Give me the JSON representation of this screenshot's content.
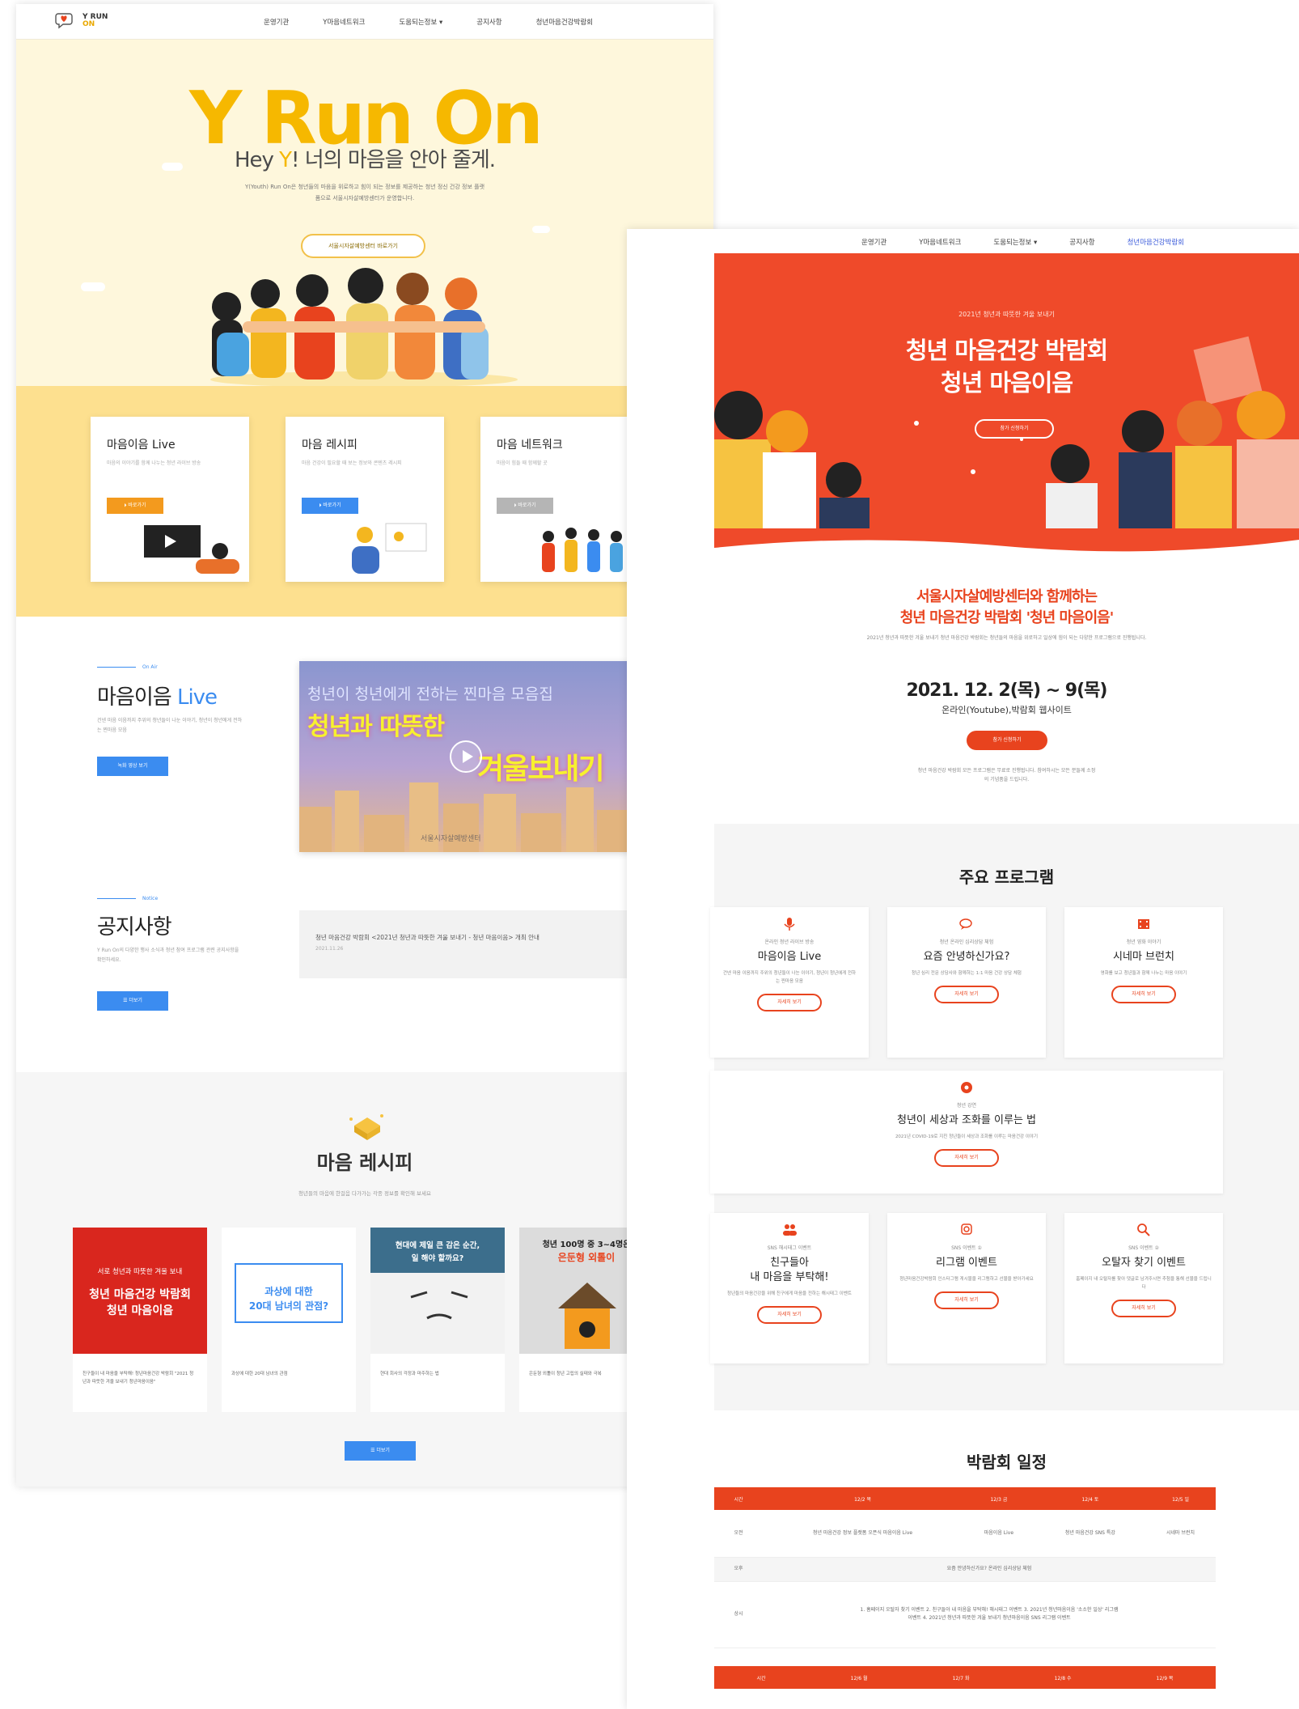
{
  "page1": {
    "logo": {
      "line1": "Y RUN",
      "line2": "ON"
    },
    "nav": [
      "운영기관",
      "Y마음네트워크",
      "도움되는정보 ▾",
      "공지사항",
      "청년마음건강박람회"
    ],
    "hero": {
      "title": "Y Run On",
      "sub_before": "Hey ",
      "sub_y": "Y",
      "sub_after": "! 너의 마음을 안아 줄게.",
      "desc": "Y(Youth) Run On은 청년들의 마음을 위로하고 힘이 되는 정보를 제공하는 청년 정신 건강 정보 플랫폼으로 서울시자살예방센터가 운영합니다.",
      "button": "서울시자살예방센터 바로가기"
    },
    "cards": [
      {
        "title": "마음이음 Live",
        "desc": "마음의 이야기를 함께 나누는 청년 라이브 방송",
        "button": "바로가기",
        "color": "#f39a1e"
      },
      {
        "title": "마음 레시피",
        "desc": "마음 건강이 필요할 때 보는 정보와 콘텐츠 레시피",
        "button": "바로가기",
        "color": "#3b8cf0"
      },
      {
        "title": "마음 네트워크",
        "desc": "마음이 힘들 때 함께할 곳",
        "button": "바로가기",
        "color": "#b5b5b5"
      }
    ],
    "live": {
      "tag": "On Air",
      "title_a": "마음이음",
      "title_b": "Live",
      "desc": "건넨 마음 이음까지 주위의 청년들이 나눈 이야기, 청년이 청년에게 전하는 찐마음 모음",
      "button": "녹화 영상 보기",
      "video_line1": "청년이 청년에게 전하는 찐마음 모음집",
      "video_line2": "청년과 따뜻한",
      "video_line3": "겨울보내기",
      "video_footer": "서울시자살예방센터"
    },
    "notice": {
      "tag": "Notice",
      "title": "공지사항",
      "desc": "Y Run On의 다양한 행사 소식과 청년 참여 프로그램 관련 공지사항을 확인하세요.",
      "button": "더보기",
      "item_title": "청년 마음건강 박람회 <2021년 청년과 따뜻한 겨울 보내기 - 청년 마음이음> 개최 안내",
      "item_date": "2021.11.26"
    },
    "recipe": {
      "title": "마음 레시피",
      "desc": "청년들의 마음에 한걸음 다가가는 각종 정보를 확인해 보세요",
      "cards": [
        {
          "img_line1": "서로 청년과 따뜻한 겨울 보내",
          "img_line2": "청년 마음건강 박람회",
          "img_line3": "청년 마음이음",
          "caption": "친구들이 내 마음을 부탁해! 청년마음건강 박람회 \"2021 청년과 따뜻한 겨울 보내기 청년마음이음\""
        },
        {
          "img_line1": "과상에 대한",
          "img_line2": "20대 남녀의 관점?",
          "caption": "과상에 대한 20대 남녀의 관점"
        },
        {
          "img_line1": "현대에 제일 큰 감은 순간,",
          "img_line2": "일 해야 할까요?",
          "caption": "현대 회사의 걱정과 마주하는 법"
        },
        {
          "img_line1": "청년 100명 중 3~4명은",
          "img_line2": "은둔형 외톨이",
          "caption": "은둔형 외톨이 청년 고립의 실태와 극복"
        }
      ],
      "button": "더보기"
    }
  },
  "page2": {
    "nav": [
      "운영기관",
      "Y마음네트워크",
      "도움되는정보 ▾",
      "공지사항",
      "청년마음건강박람회"
    ],
    "hero": {
      "small": "2021년 청년과 따뜻한 겨울 보내기",
      "title_line1": "청년 마음건강 박람회",
      "title_line2": "청년 마음이음",
      "button": "참가 신청하기"
    },
    "intro": {
      "line1": "서울시자살예방센터와 함께하는",
      "line2": "청년 마음건강 박람회 '청년 마음이음'",
      "desc": "2021년 청년과 따뜻한 겨울 보내기 청년 마음건강 박람회는 청년들의 마음을 위로하고 일상에 힘이 되는 다양한 프로그램으로 진행됩니다.",
      "date": "2021. 12. 2(목) ~ 9(목)",
      "place": "온라인(Youtube),박람회 웹사이트",
      "button": "참가 신청하기",
      "note": "청년 마음건강 박람회 모든 프로그램은 무료로 진행됩니다. 참여하시는 모든 분들께 소정의 기념품을 드립니다."
    },
    "programs": {
      "title": "주요 프로그램",
      "items": [
        {
          "icon": "mic-icon",
          "sub": "온라인 청년 라이브 방송",
          "title": "마음이음 Live",
          "desc": "건넨 마음 이음까지 주위의 청년들이 나눈 이야기, 청년이 청년에게 전하는 찐마음 모음",
          "button": "자세히 보기"
        },
        {
          "icon": "chat-icon",
          "sub": "청년 온라인 심리상담 체험",
          "title": "요즘 안녕하신가요?",
          "desc": "청년 심리 전문 상담사와 함께하는 1:1 마음 건강 상담 체험",
          "button": "자세히 보기"
        },
        {
          "icon": "film-icon",
          "sub": "청년 영화 이야기",
          "title": "시네마 브런치",
          "desc": "영화를 보고 청년들과 함께 나누는 마음 이야기",
          "button": "자세히 보기"
        },
        {
          "icon": "circle-icon",
          "sub": "청년 강연",
          "title": "청년이 세상과 조화를 이루는 법",
          "desc": "2021년 COVID-19로 지친 청년들이 세상과 조화를 이루는 마음건강 이야기",
          "button": "자세히 보기"
        },
        {
          "icon": "people-icon",
          "sub": "SNS 해시태그 이벤트",
          "title_line1": "친구들아",
          "title_line2": "내 마음을 부탁해!",
          "desc": "청년들의 마음건강을 위해 친구에게 마음을 전하는 해시태그 이벤트",
          "button": "자세히 보기"
        },
        {
          "icon": "instagram-icon",
          "sub": "SNS 이벤트 ①",
          "title": "리그램 이벤트",
          "desc": "청년마음건강박람회 인스타그램 게시물을 리그램하고 선물을 받아가세요",
          "button": "자세히 보기"
        },
        {
          "icon": "search-icon",
          "sub": "SNS 이벤트 ②",
          "title": "오탈자 찾기 이벤트",
          "desc": "홈페이지 내 오탈자를 찾아 댓글로 남겨주시면 추첨을 통해 선물을 드립니다",
          "button": "자세히 보기"
        }
      ]
    },
    "schedule": {
      "title": "박람회 일정",
      "headers": [
        "시간",
        "12/2 목",
        "12/3 금",
        "12/4 토",
        "12/5 일"
      ],
      "rows": [
        {
          "time": "오전",
          "cells": [
            "청년 마음건강 정보 플랫폼 오픈식 마음이음 Live",
            "마음이음 Live",
            "청년 마음건강 SNS 특강",
            "시네마 브런치"
          ]
        },
        {
          "time": "오후",
          "cells_merged": "요즘 안녕하신가요? 온라인 심리상담 체험"
        },
        {
          "time": "상시",
          "cells_merged": "1. 홈페이지 오탈자 찾기 이벤트 2. 친구들아 내 마음을 부탁해! 해시태그 이벤트 3. 2021년 청년마음이음 '소소한 일상' 리그램 이벤트 4. 2021년 청년과 따뜻한 겨울 보내기 청년마음이음 SNS 리그램 이벤트"
        }
      ],
      "footer": [
        "시간",
        "12/6 월",
        "12/7 화",
        "12/8 수",
        "12/9 목"
      ]
    }
  },
  "colors": {
    "yellow": "#f6b800",
    "blue": "#3b8cf0",
    "red": "#e8431e"
  }
}
